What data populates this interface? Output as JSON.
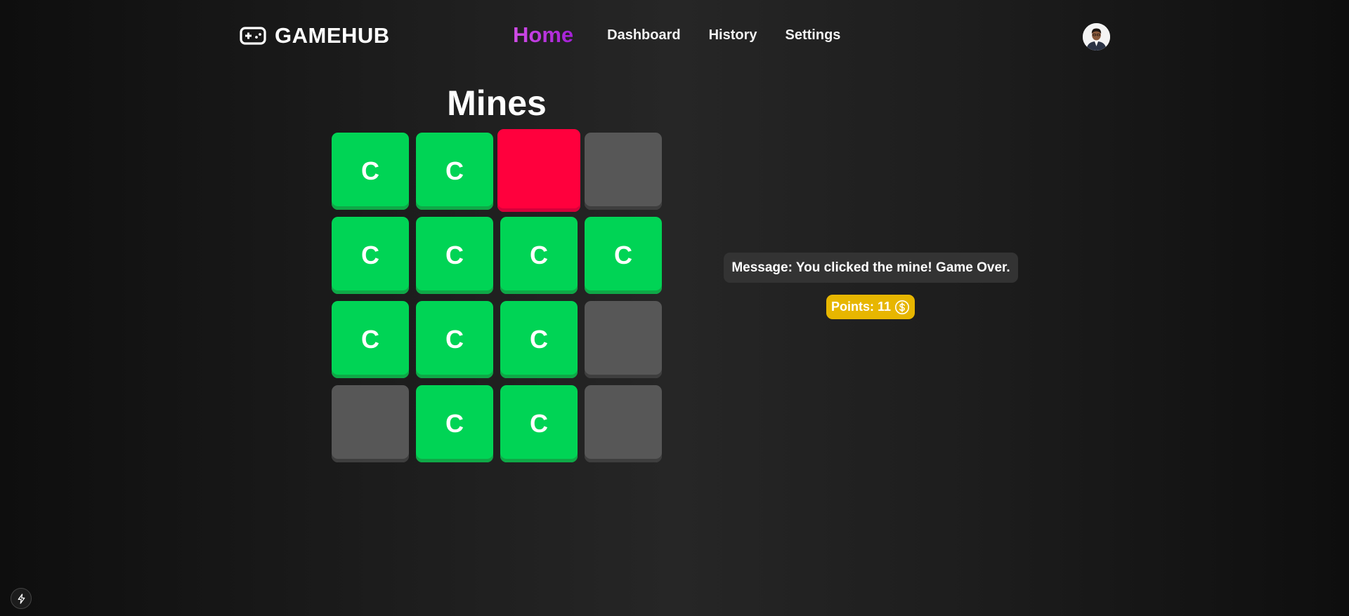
{
  "nav": {
    "brand": "GAMEHUB",
    "links": [
      {
        "label": "Home",
        "active": true
      },
      {
        "label": "Dashboard",
        "active": false
      },
      {
        "label": "History",
        "active": false
      },
      {
        "label": "Settings",
        "active": false
      }
    ]
  },
  "game": {
    "title": "Mines",
    "rows": 4,
    "cols": 4,
    "tiles": [
      {
        "state": "coin",
        "label": "C"
      },
      {
        "state": "coin",
        "label": "C"
      },
      {
        "state": "mine",
        "label": ""
      },
      {
        "state": "hidden",
        "label": ""
      },
      {
        "state": "coin",
        "label": "C"
      },
      {
        "state": "coin",
        "label": "C"
      },
      {
        "state": "coin",
        "label": "C"
      },
      {
        "state": "coin",
        "label": "C"
      },
      {
        "state": "coin",
        "label": "C"
      },
      {
        "state": "coin",
        "label": "C"
      },
      {
        "state": "coin",
        "label": "C"
      },
      {
        "state": "hidden",
        "label": ""
      },
      {
        "state": "hidden",
        "label": ""
      },
      {
        "state": "coin",
        "label": "C"
      },
      {
        "state": "coin",
        "label": "C"
      },
      {
        "state": "hidden",
        "label": ""
      }
    ]
  },
  "status": {
    "message": "Message: You clicked the mine! Game Over.",
    "points": "Points: 11"
  },
  "icons": {
    "brand": "gamepad-icon",
    "coin": "dollar-coin-icon",
    "dev": "lightning-icon"
  },
  "colors": {
    "coin_tile": "#00d455",
    "mine_tile": "#ff003d",
    "hidden_tile": "#575757",
    "points_badge": "#e7b600",
    "message_bg": "#333333",
    "home_link": "#c43ee0"
  }
}
